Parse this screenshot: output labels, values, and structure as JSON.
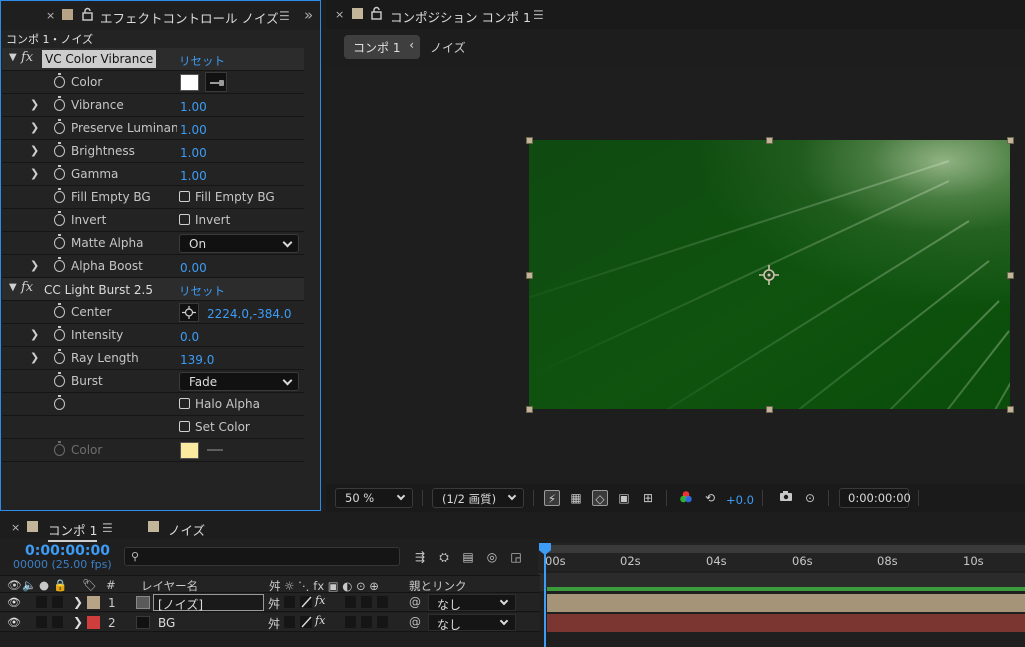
{
  "effect_controls": {
    "close": "×",
    "tab_title": "エフェクトコントロール ノイズ",
    "menu": "☰",
    "overflow": "»",
    "path": "コンポ 1・ノイズ",
    "effects": [
      {
        "name": "VC Color Vibrance",
        "reset": "リセット",
        "props": {
          "color": {
            "label": "Color",
            "swatch": "#ffffff"
          },
          "vibrance": {
            "label": "Vibrance",
            "value": "1.00"
          },
          "preserve": {
            "label": "Preserve Luminanc",
            "value": "1.00"
          },
          "brightness": {
            "label": "Brightness",
            "value": "1.00"
          },
          "gamma": {
            "label": "Gamma",
            "value": "1.00"
          },
          "fill_empty": {
            "label": "Fill Empty BG",
            "checkbox": "Fill Empty BG"
          },
          "invert": {
            "label": "Invert",
            "checkbox": "Invert"
          },
          "matte_alpha": {
            "label": "Matte Alpha",
            "value": "On"
          },
          "alpha_boost": {
            "label": "Alpha Boost",
            "value": "0.00"
          }
        }
      },
      {
        "name": "CC Light Burst 2.5",
        "reset": "リセット",
        "props": {
          "center": {
            "label": "Center",
            "value": "2224.0,-384.0"
          },
          "intensity": {
            "label": "Intensity",
            "value": "0.0"
          },
          "ray_length": {
            "label": "Ray Length",
            "value": "139.0"
          },
          "burst": {
            "label": "Burst",
            "value": "Fade"
          },
          "halo": {
            "checkbox": "Halo Alpha"
          },
          "set_color": {
            "checkbox": "Set Color"
          },
          "color": {
            "label": "Color",
            "swatch": "#fbeba0"
          }
        }
      }
    ]
  },
  "composition": {
    "close": "×",
    "tab_title": "コンポジション コンポ 1",
    "menu": "☰",
    "breadcrumb": [
      "コンポ 1",
      "ノイズ"
    ],
    "breadcrumb_arrow": "‹",
    "toolbar": {
      "zoom": "50 %",
      "resolution": "(1/2 画質)",
      "exposure": "+0.0",
      "timecode": "0:00:00:00"
    }
  },
  "timeline": {
    "close": "×",
    "tabs": [
      "コンポ 1",
      "ノイズ"
    ],
    "menu": "☰",
    "timecode": "0:00:00:00",
    "fps": "00000 (25.00 fps)",
    "search_placeholder": "",
    "ruler_ticks": [
      "00s",
      "02s",
      "04s",
      "06s",
      "08s",
      "10s"
    ],
    "headers": {
      "number": "#",
      "layer_name": "レイヤー名",
      "parent": "親とリンク"
    },
    "layers": [
      {
        "index": "1",
        "name": "[ノイズ]",
        "label_color": "#b7a385",
        "parent": "なし",
        "bar_color": "#a69478"
      },
      {
        "index": "2",
        "name": "BG",
        "label_color": "#cf3d3d",
        "parent": "なし",
        "bar_color": "#7b3632"
      }
    ]
  }
}
